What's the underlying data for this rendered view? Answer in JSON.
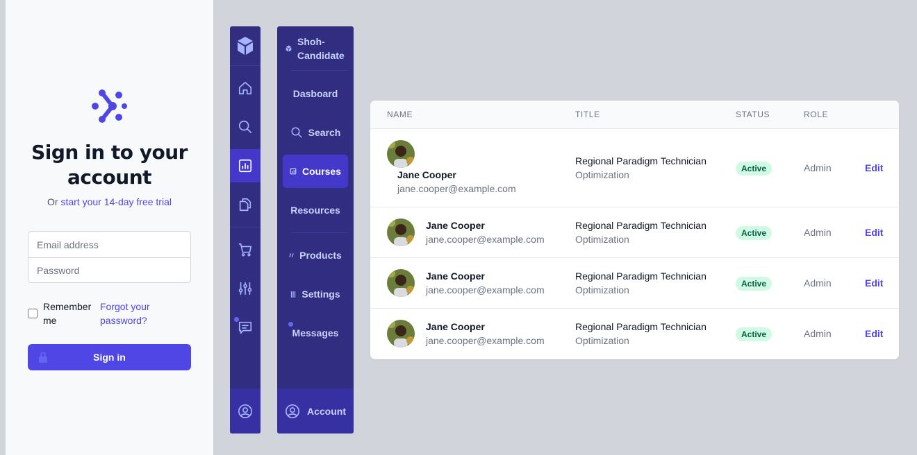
{
  "signin": {
    "title": "Sign in to your account",
    "subtitle_prefix": "Or",
    "trial_link": "start your 14-day free trial",
    "email_placeholder": "Email address",
    "password_placeholder": "Password",
    "remember_label": "Remember me",
    "forgot_link": "Forgot your password?",
    "submit_label": "Sign in",
    "logo_icon": "molecule-logo-icon",
    "lock_icon": "lock-icon"
  },
  "icon_sidebar": {
    "logo_icon": "cube-icon",
    "items": [
      {
        "icon": "home-icon"
      },
      {
        "icon": "search-icon"
      },
      {
        "icon": "chart-bar-icon",
        "active": true
      },
      {
        "icon": "copy-icon"
      },
      {
        "icon": "cart-icon"
      },
      {
        "icon": "sliders-icon"
      },
      {
        "icon": "chat-icon",
        "notification_dot": true
      }
    ],
    "footer_icon": "user-circle-icon"
  },
  "nav_sidebar": {
    "brand": "Shoh-Candidate",
    "items": [
      {
        "label": "Dasboard"
      },
      {
        "label": "Search",
        "icon": "search-icon"
      },
      {
        "label": "Courses",
        "icon": "chart-icon",
        "active": true
      },
      {
        "label": "Resources"
      },
      {
        "label": "Products",
        "icon": "tag-icon"
      },
      {
        "label": "Settings",
        "icon": "sliders-icon"
      },
      {
        "label": "Messages",
        "notification_dot": true
      }
    ],
    "account_label": "Account"
  },
  "table": {
    "columns": [
      "NAME",
      "TITLE",
      "STATUS",
      "ROLE"
    ],
    "rows": [
      {
        "name": "Jane Cooper",
        "email": "jane.cooper@example.com",
        "title": "Regional Paradigm Technician",
        "department": "Optimization",
        "status": "Active",
        "role": "Admin",
        "action": "Edit"
      },
      {
        "name": "Jane Cooper",
        "email": "jane.cooper@example.com",
        "title": "Regional Paradigm Technician",
        "department": "Optimization",
        "status": "Active",
        "role": "Admin",
        "action": "Edit"
      },
      {
        "name": "Jane Cooper",
        "email": "jane.cooper@example.com",
        "title": "Regional Paradigm Technician",
        "department": "Optimization",
        "status": "Active",
        "role": "Admin",
        "action": "Edit"
      },
      {
        "name": "Jane Cooper",
        "email": "jane.cooper@example.com",
        "title": "Regional Paradigm Technician",
        "department": "Optimization",
        "status": "Active",
        "role": "Admin",
        "action": "Edit"
      }
    ]
  },
  "colors": {
    "primary": "#4f46e5",
    "sidebar": "#312e81",
    "sidebar_active": "#4338ca",
    "badge_bg": "#d1fae5",
    "badge_text": "#065f46"
  }
}
